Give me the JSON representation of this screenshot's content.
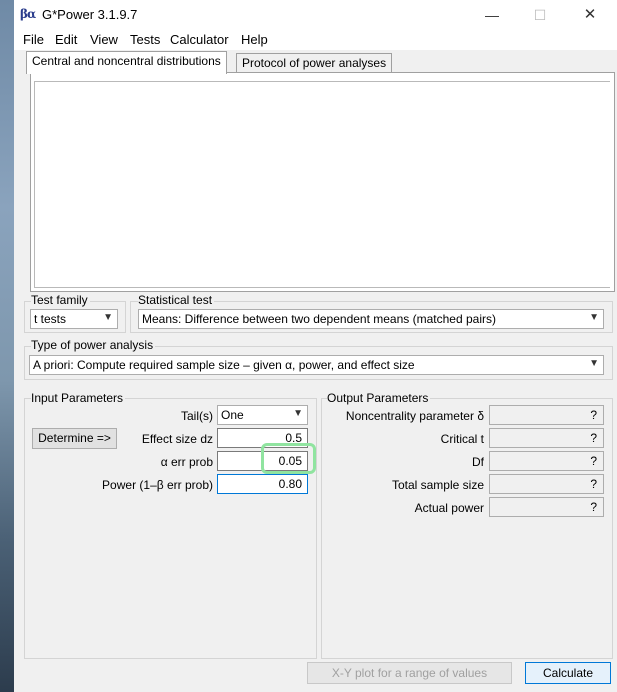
{
  "window": {
    "title": "G*Power 3.1.9.7",
    "app_icon": "βα",
    "controls": {
      "minimize": "—",
      "maximize": "☐",
      "close": "✕"
    }
  },
  "menu": [
    "File",
    "Edit",
    "View",
    "Tests",
    "Calculator",
    "Help"
  ],
  "tabs": [
    {
      "label": "Central and noncentral distributions",
      "active": true
    },
    {
      "label": "Protocol of power analyses",
      "active": false
    }
  ],
  "test_family": {
    "label": "Test family",
    "value": "t tests"
  },
  "statistical_test": {
    "label": "Statistical test",
    "value": "Means: Difference between two dependent means (matched pairs)"
  },
  "power_analysis": {
    "label": "Type of power analysis",
    "value": "A priori: Compute required sample size – given α, power, and effect size"
  },
  "input": {
    "label": "Input Parameters",
    "determine_button": "Determine =>",
    "tails": {
      "label": "Tail(s)",
      "value": "One"
    },
    "effect_size": {
      "label": "Effect size dz",
      "value": "0.5"
    },
    "alpha": {
      "label": "α err prob",
      "value": "0.05"
    },
    "power": {
      "label": "Power (1–β err prob)",
      "value": "0.80"
    }
  },
  "output": {
    "label": "Output Parameters",
    "rows": [
      {
        "label": "Noncentrality parameter δ",
        "value": "?"
      },
      {
        "label": "Critical t",
        "value": "?"
      },
      {
        "label": "Df",
        "value": "?"
      },
      {
        "label": "Total sample size",
        "value": "?"
      },
      {
        "label": "Actual power",
        "value": "?"
      }
    ]
  },
  "buttons": {
    "xy_plot": "X-Y plot for a range of values",
    "calculate": "Calculate"
  },
  "colors": {
    "highlight": "#90e4a0",
    "window_bg": "#f0f0f0"
  }
}
